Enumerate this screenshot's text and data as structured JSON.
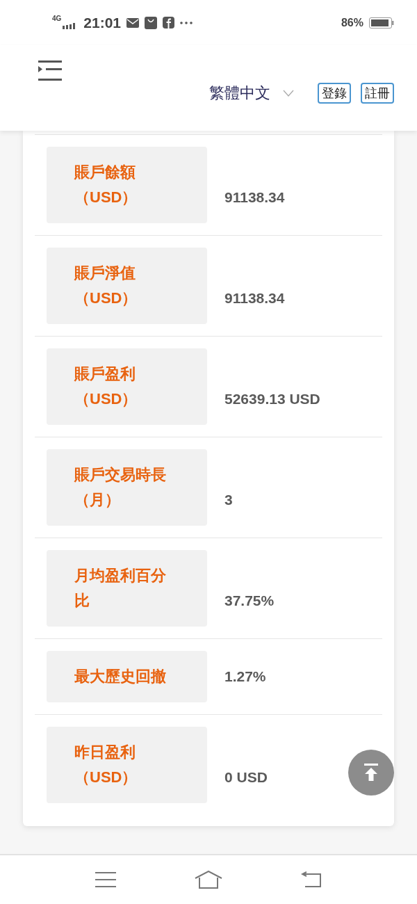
{
  "status_bar": {
    "network": "4G",
    "time": "21:01",
    "battery": "86%"
  },
  "header": {
    "language": "繁體中文",
    "buttons": [
      "登錄",
      "註冊"
    ]
  },
  "rows": [
    {
      "label": "賬戶餘額（USD）",
      "value": "91138.34"
    },
    {
      "label": "賬戶淨值（USD）",
      "value": "91138.34"
    },
    {
      "label": "賬戶盈利（USD）",
      "value": "52639.13 USD"
    },
    {
      "label": "賬戶交易時長（月）",
      "value": "3"
    },
    {
      "label": "月均盈利百分比",
      "value": "37.75%"
    },
    {
      "label": "最大歷史回撤",
      "value": "1.27%"
    },
    {
      "label": "昨日盈利（USD）",
      "value": "0 USD"
    }
  ]
}
